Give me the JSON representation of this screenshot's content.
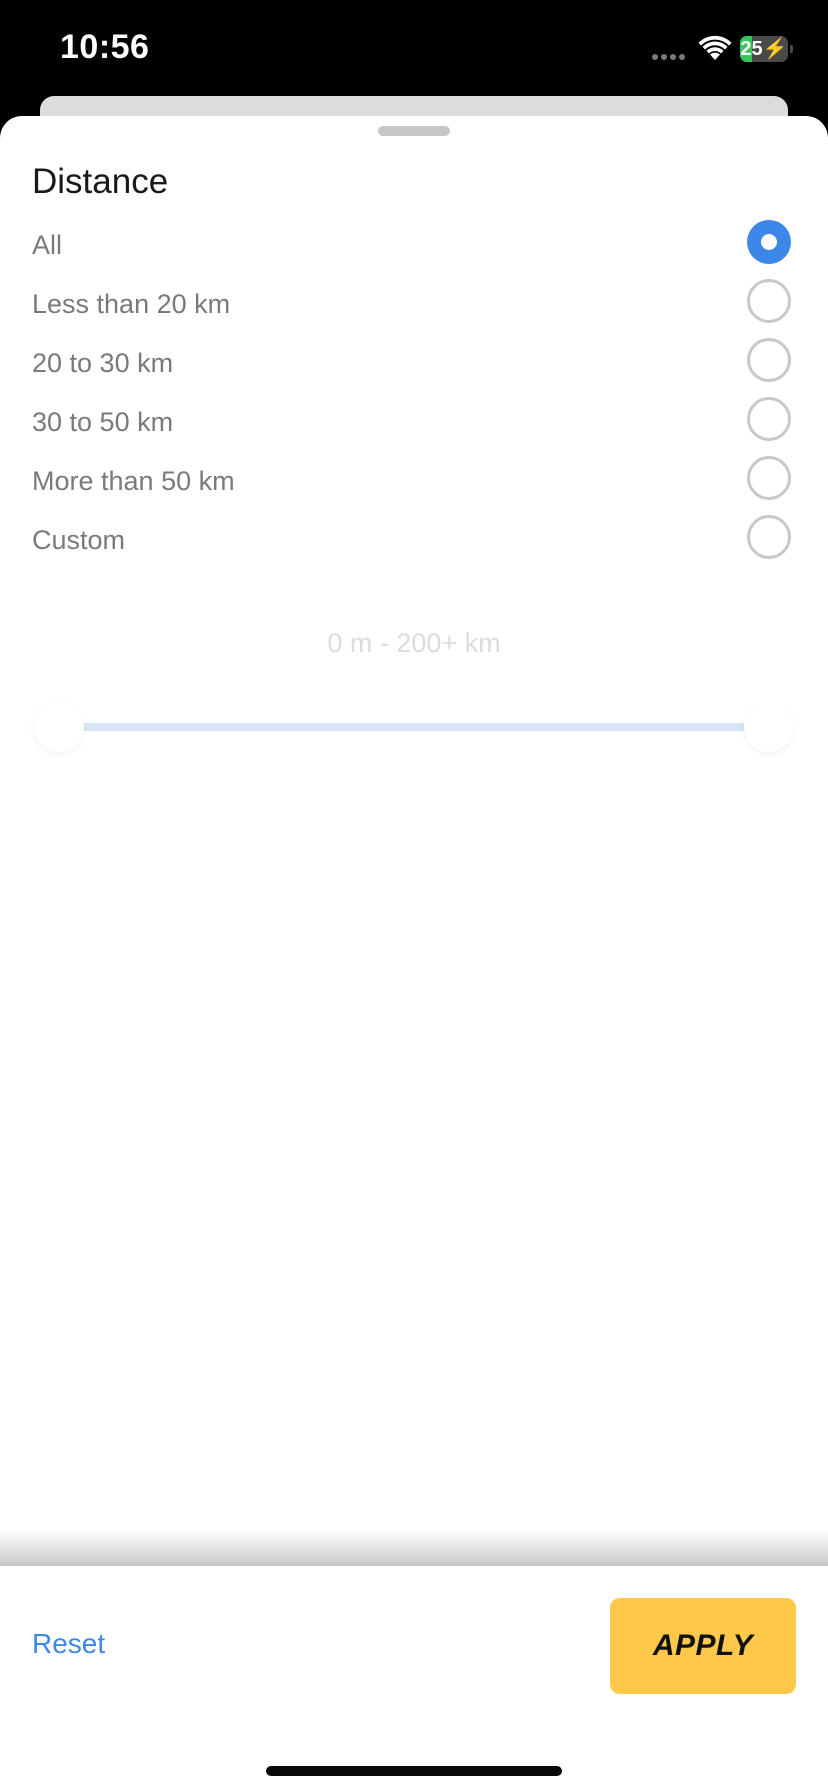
{
  "status_bar": {
    "time": "10:56",
    "battery_level": "25",
    "battery_fraction": 0.25,
    "charging": true
  },
  "filter": {
    "title": "Distance",
    "options": [
      {
        "label": "All",
        "selected": true
      },
      {
        "label": "Less than 20 km",
        "selected": false
      },
      {
        "label": "20 to 30 km",
        "selected": false
      },
      {
        "label": "30 to 50 km",
        "selected": false
      },
      {
        "label": "More than 50 km",
        "selected": false
      },
      {
        "label": "Custom",
        "selected": false
      }
    ],
    "range_text": "0 m - 200+ km"
  },
  "footer": {
    "reset_label": "Reset",
    "apply_label": "APPLY"
  },
  "colors": {
    "accent": "#3d87e8",
    "apply_button": "#fec94a",
    "battery_fill": "#34c759"
  }
}
